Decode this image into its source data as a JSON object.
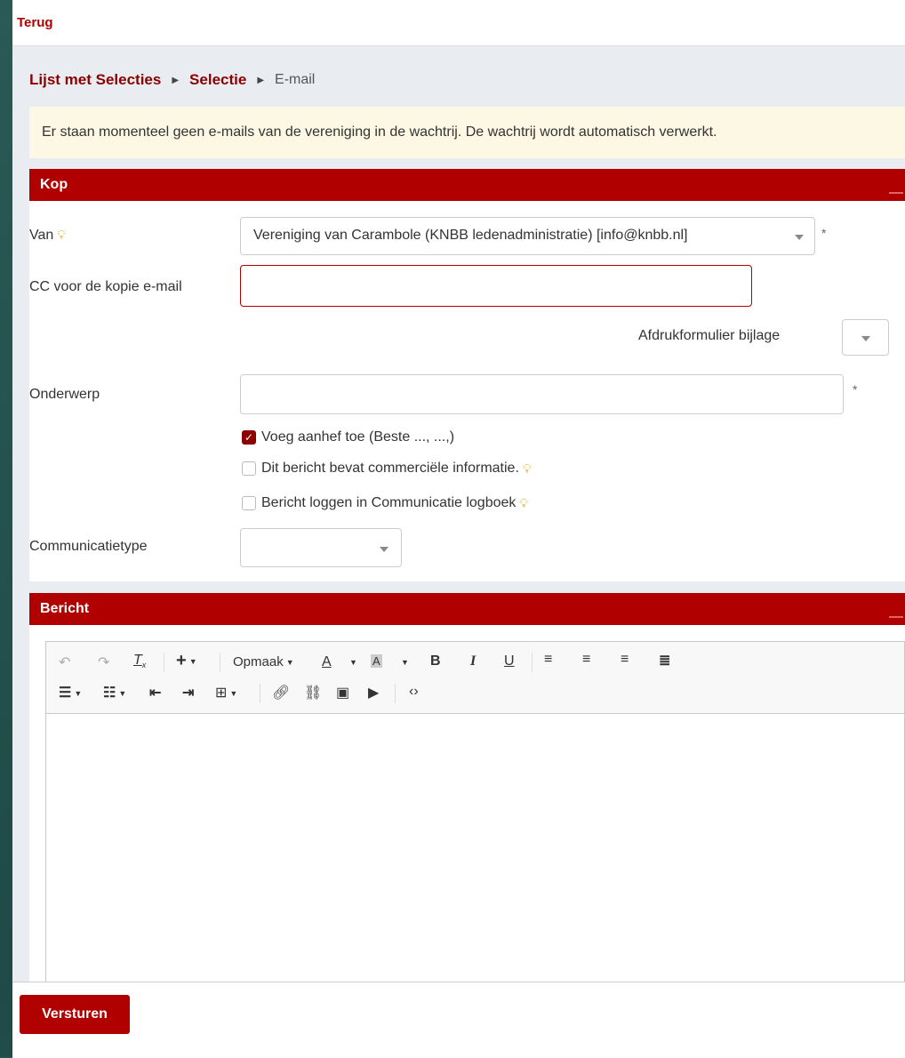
{
  "topbar": {
    "back_label": "Terug"
  },
  "breadcrumb": {
    "items": [
      "Lijst met Selecties",
      "Selectie",
      "E-mail"
    ]
  },
  "notice": "Er staan momenteel geen e-mails van de vereniging in de wachtrij. De wachtrij wordt automatisch verwerkt.",
  "kop": {
    "title": "Kop",
    "van_label": "Van",
    "van_value": "Vereniging van Carambole (KNBB ledenadministratie) [info@knbb.nl]",
    "cc_label": "CC voor de kopie e-mail",
    "cc_value": "",
    "afdruk_label": "Afdrukformulier bijlage",
    "onderwerp_label": "Onderwerp",
    "onderwerp_value": "",
    "required_mark": "*",
    "checkboxes": [
      {
        "label": "Voeg aanhef toe (Beste ..., ...,)",
        "checked": true
      },
      {
        "label": "Dit bericht bevat commerciële informatie.",
        "checked": false
      },
      {
        "label": "Bericht loggen in Communicatie logboek",
        "checked": false
      }
    ],
    "communicatietype_label": "Communicatietype"
  },
  "bericht": {
    "title": "Bericht",
    "toolbar": {
      "opmaak_label": "Opmaak"
    }
  },
  "footer": {
    "send_label": "Versturen"
  },
  "colors": {
    "brand": "#b00000",
    "notice_bg": "#fcf8e3",
    "bulb": "#d4a017"
  }
}
